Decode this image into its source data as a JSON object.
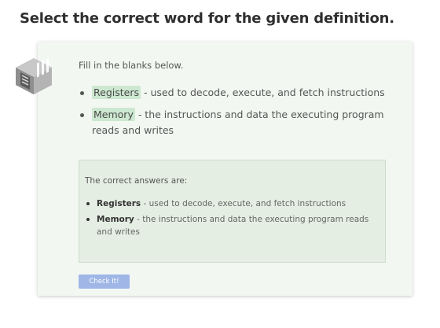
{
  "heading": "Select the correct word for the given definition.",
  "card": {
    "logo_icon": "server-rack-logo-icon",
    "instructions": "Fill in the blanks below.",
    "items": [
      {
        "blank": "Registers",
        "definition": " - used to decode, execute, and fetch instructions"
      },
      {
        "blank": "Memory",
        "definition": " - the instructions and data the executing program reads and writes"
      }
    ],
    "answers": {
      "title": "The correct answers are:",
      "items": [
        {
          "term": "Registers",
          "definition": " - used to decode, execute, and fetch instructions"
        },
        {
          "term": "Memory",
          "definition": " - the instructions and data the executing program reads and writes"
        }
      ]
    },
    "check_button": "Check It!"
  },
  "colors": {
    "card_background": "#f2f7f2",
    "blank_highlight": "#cde8d0",
    "answers_background": "#e4eee2",
    "button_background": "#9fb6e6"
  }
}
